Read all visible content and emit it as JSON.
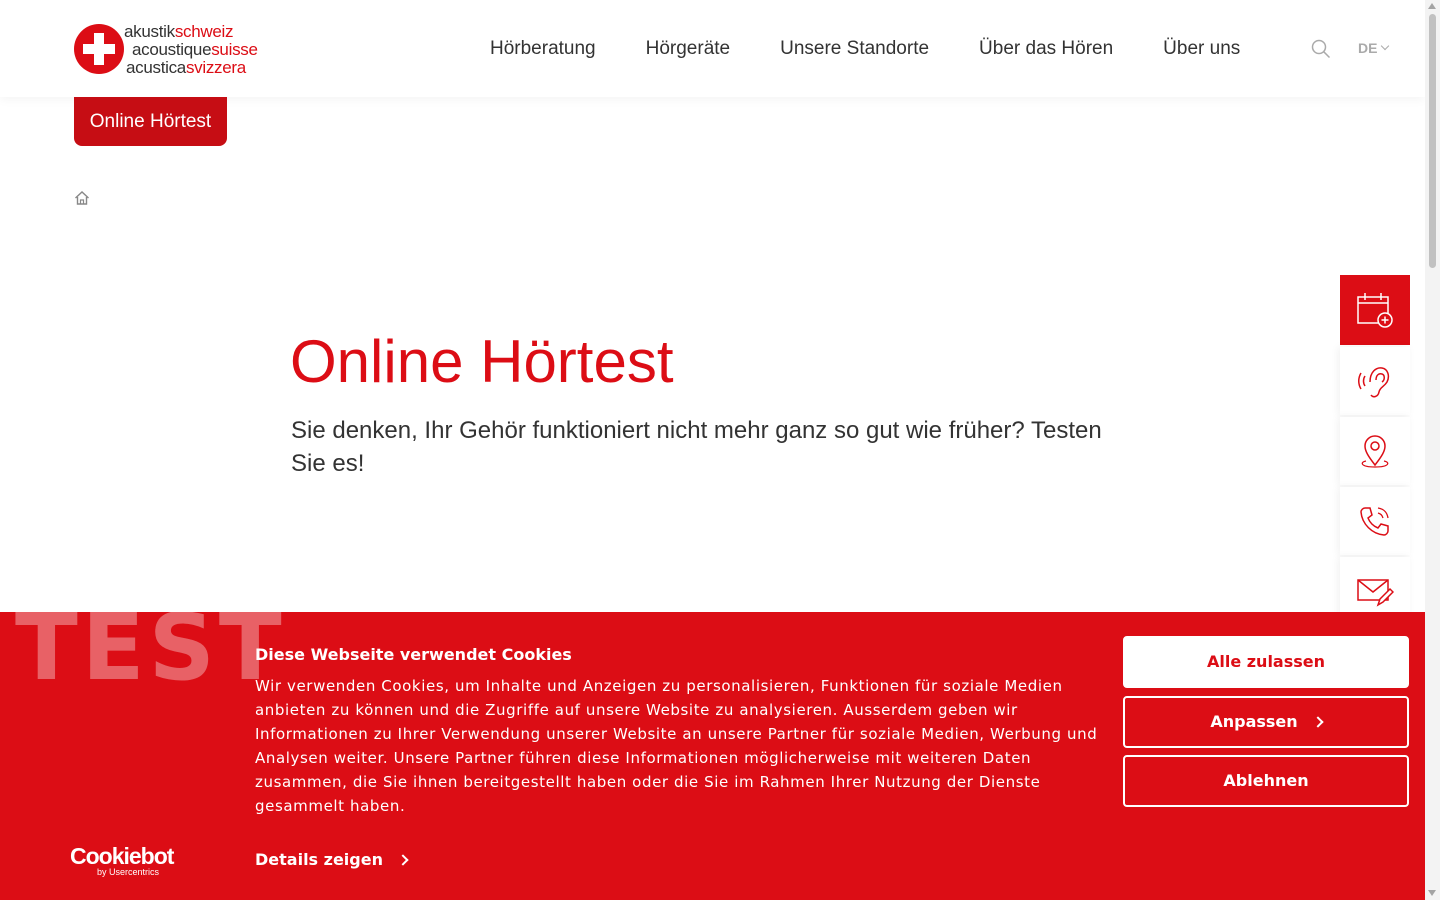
{
  "header": {
    "logo": {
      "line1": {
        "a": "akustik",
        "b": "schweiz"
      },
      "line2": {
        "a": "acoustique",
        "b": "suisse"
      },
      "line3": {
        "a": "acustica",
        "b": "svizzera"
      }
    },
    "nav": [
      "Hörberatung",
      "Hörgeräte",
      "Unsere Standorte",
      "Über das Hören",
      "Über uns"
    ],
    "language": "DE"
  },
  "cta_tab": "Online Hörtest",
  "hero": {
    "title": "Online Hörtest",
    "subtitle": "Sie denken, Ihr Gehör funktioniert nicht mehr ganz so gut wie früher? Testen Sie es!"
  },
  "quickbar": [
    "calendar-add-icon",
    "ear-icon",
    "location-pin-icon",
    "phone-icon",
    "mail-edit-icon"
  ],
  "cookie": {
    "watermark": "TEST",
    "title": "Diese Webseite verwendet Cookies",
    "text": "Wir verwenden Cookies, um Inhalte und Anzeigen zu personalisieren, Funktionen für soziale Medien anbieten zu können und die Zugriffe auf unsere Website zu analysieren. Ausserdem geben wir Informationen zu Ihrer Verwendung unserer Website an unsere Partner für soziale Medien, Werbung und Analysen weiter. Unsere Partner führen diese Informationen möglicherweise mit weiteren Daten zusammen, die Sie ihnen bereitgestellt haben oder die Sie im Rahmen Ihrer Nutzung der Dienste gesammelt haben.",
    "allow_all": "Alle zulassen",
    "customize": "Anpassen",
    "deny": "Ablehnen",
    "details": "Details zeigen",
    "brand": "Cookiebot",
    "brand_sub": "by Usercentrics"
  },
  "colors": {
    "brand_red": "#dc0d15",
    "cta_red": "#c60d14",
    "text": "#333333"
  }
}
